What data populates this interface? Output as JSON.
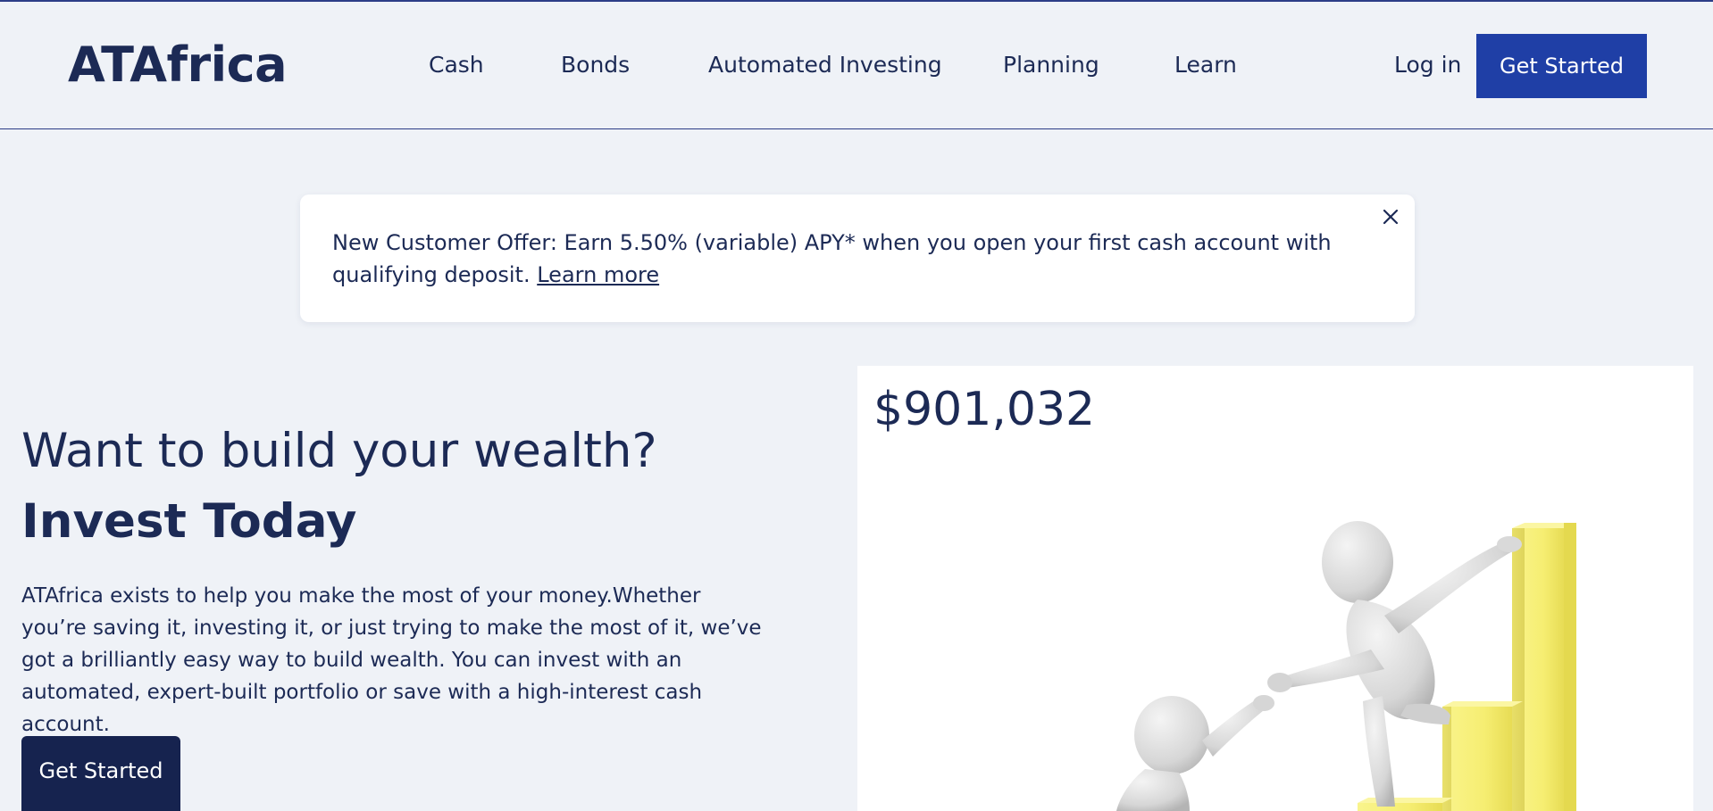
{
  "header": {
    "logo": "ATAfrica",
    "nav": [
      {
        "label": "Cash"
      },
      {
        "label": "Bonds"
      },
      {
        "label": "Automated Investing"
      },
      {
        "label": "Planning"
      },
      {
        "label": "Learn"
      }
    ],
    "login_label": "Log in",
    "cta_label": "Get Started"
  },
  "banner": {
    "text": "New Customer Offer: Earn 5.50% (variable) APY* when you open your first cash account with qualifying deposit.",
    "link_label": "Learn more",
    "close_icon": "close-icon"
  },
  "hero": {
    "title": "Want to build your wealth?",
    "subtitle": "Invest Today",
    "body": "ATAfrica exists to help you make the most of your money.Whether you’re saving it, investing it, or just trying to make the most of it, we’ve got a brilliantly easy way to build wealth. You can invest with an automated, expert-built portfolio or save with a high-interest cash account.",
    "cta_label": "Get Started"
  },
  "visual": {
    "portfolio_value": "$901,032",
    "illustration": "helping-hand-climbing-bars-illustration"
  },
  "colors": {
    "page_background": "#eff2f7",
    "text_navy": "#1c2a55",
    "header_cta": "#1f3fa6",
    "hero_cta": "#16234f",
    "header_rule": "#2c3d87",
    "bar_yellow": "#f7f07a"
  }
}
